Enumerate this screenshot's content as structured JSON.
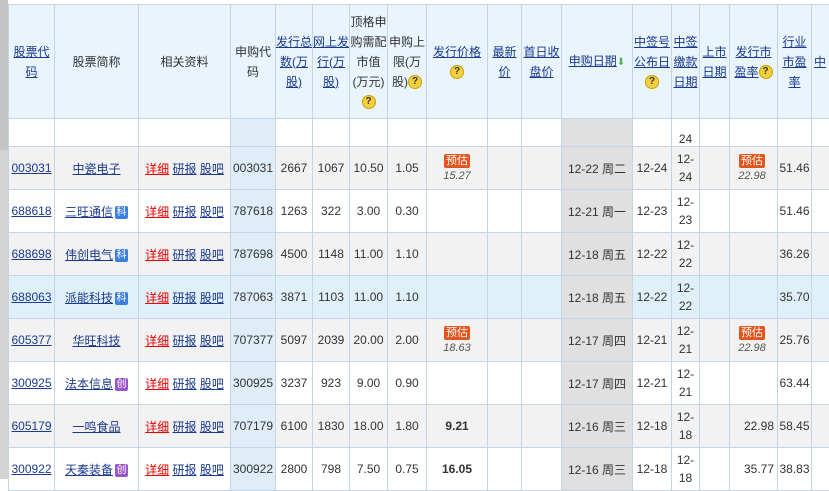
{
  "headers": {
    "code": "股票代码",
    "name": "股票简称",
    "info": "相关资料",
    "sub_code": "申购代码",
    "total": "发行总数(万股)",
    "online": "网上发行(万股)",
    "top_mv": "顶格申购需配市值(万元)",
    "limit": "申购上限(万股)",
    "price": "发行价格",
    "latest": "最新价",
    "first_close": "首日收盘价",
    "sub_date": "申购日期",
    "lot_pub": "中签号公布日",
    "pay_date": "中签缴款日期",
    "list_date": "上市日期",
    "pe": "发行市盈率",
    "ind_pe": "行业市盈率",
    "next": "中"
  },
  "help_icon": "?",
  "sort_icon": "⬇",
  "links": {
    "detail": "详细",
    "report": "研报",
    "forum": "股吧"
  },
  "estimate_label": "预估",
  "partial_row": {
    "pay_date": "24"
  },
  "rows": [
    {
      "code": "003031",
      "name": "中瓷电子",
      "badge": "",
      "sub_code": "003031",
      "total": "2667",
      "online": "1067",
      "top_mv": "10.50",
      "limit": "1.05",
      "price": "",
      "price_est": "15.27",
      "latest": "",
      "first_close": "",
      "sub_date": "12-22 周二",
      "lot_pub": "12-24",
      "pay_date": "12-24",
      "list_date": "",
      "pe": "",
      "pe_est": "22.98",
      "ind_pe": "51.46"
    },
    {
      "code": "688618",
      "name": "三旺通信",
      "badge": "科",
      "sub_code": "787618",
      "total": "1263",
      "online": "322",
      "top_mv": "3.00",
      "limit": "0.30",
      "price": "",
      "price_est": "",
      "latest": "",
      "first_close": "",
      "sub_date": "12-21 周一",
      "lot_pub": "12-23",
      "pay_date": "12-23",
      "list_date": "",
      "pe": "",
      "pe_est": "",
      "ind_pe": "51.46"
    },
    {
      "code": "688698",
      "name": "伟创电气",
      "badge": "科",
      "sub_code": "787698",
      "total": "4500",
      "online": "1148",
      "top_mv": "11.00",
      "limit": "1.10",
      "price": "",
      "price_est": "",
      "latest": "",
      "first_close": "",
      "sub_date": "12-18 周五",
      "lot_pub": "12-22",
      "pay_date": "12-22",
      "list_date": "",
      "pe": "",
      "pe_est": "",
      "ind_pe": "36.26"
    },
    {
      "code": "688063",
      "name": "派能科技",
      "badge": "科",
      "sub_code": "787063",
      "total": "3871",
      "online": "1103",
      "top_mv": "11.00",
      "limit": "1.10",
      "price": "",
      "price_est": "",
      "latest": "",
      "first_close": "",
      "sub_date": "12-18 周五",
      "lot_pub": "12-22",
      "pay_date": "12-22",
      "list_date": "",
      "pe": "",
      "pe_est": "",
      "ind_pe": "35.70"
    },
    {
      "code": "605377",
      "name": "华旺科技",
      "badge": "",
      "sub_code": "707377",
      "total": "5097",
      "online": "2039",
      "top_mv": "20.00",
      "limit": "2.00",
      "price": "",
      "price_est": "18.63",
      "latest": "",
      "first_close": "",
      "sub_date": "12-17 周四",
      "lot_pub": "12-21",
      "pay_date": "12-21",
      "list_date": "",
      "pe": "",
      "pe_est": "22.98",
      "ind_pe": "25.76"
    },
    {
      "code": "300925",
      "name": "法本信息",
      "badge": "创",
      "sub_code": "300925",
      "total": "3237",
      "online": "923",
      "top_mv": "9.00",
      "limit": "0.90",
      "price": "",
      "price_est": "",
      "latest": "",
      "first_close": "",
      "sub_date": "12-17 周四",
      "lot_pub": "12-21",
      "pay_date": "12-21",
      "list_date": "",
      "pe": "",
      "pe_est": "",
      "ind_pe": "63.44"
    },
    {
      "code": "605179",
      "name": "一鸣食品",
      "badge": "",
      "sub_code": "707179",
      "total": "6100",
      "online": "1830",
      "top_mv": "18.00",
      "limit": "1.80",
      "price": "9.21",
      "price_est": "",
      "latest": "",
      "first_close": "",
      "sub_date": "12-16 周三",
      "lot_pub": "12-18",
      "pay_date": "12-18",
      "list_date": "",
      "pe": "22.98",
      "pe_est": "",
      "ind_pe": "58.45"
    },
    {
      "code": "300922",
      "name": "天秦装备",
      "badge": "创",
      "sub_code": "300922",
      "total": "2800",
      "online": "798",
      "top_mv": "7.50",
      "limit": "0.75",
      "price": "16.05",
      "price_est": "",
      "latest": "",
      "first_close": "",
      "sub_date": "12-16 周三",
      "lot_pub": "12-18",
      "pay_date": "12-18",
      "list_date": "",
      "pe": "35.77",
      "pe_est": "",
      "ind_pe": "38.83"
    }
  ]
}
